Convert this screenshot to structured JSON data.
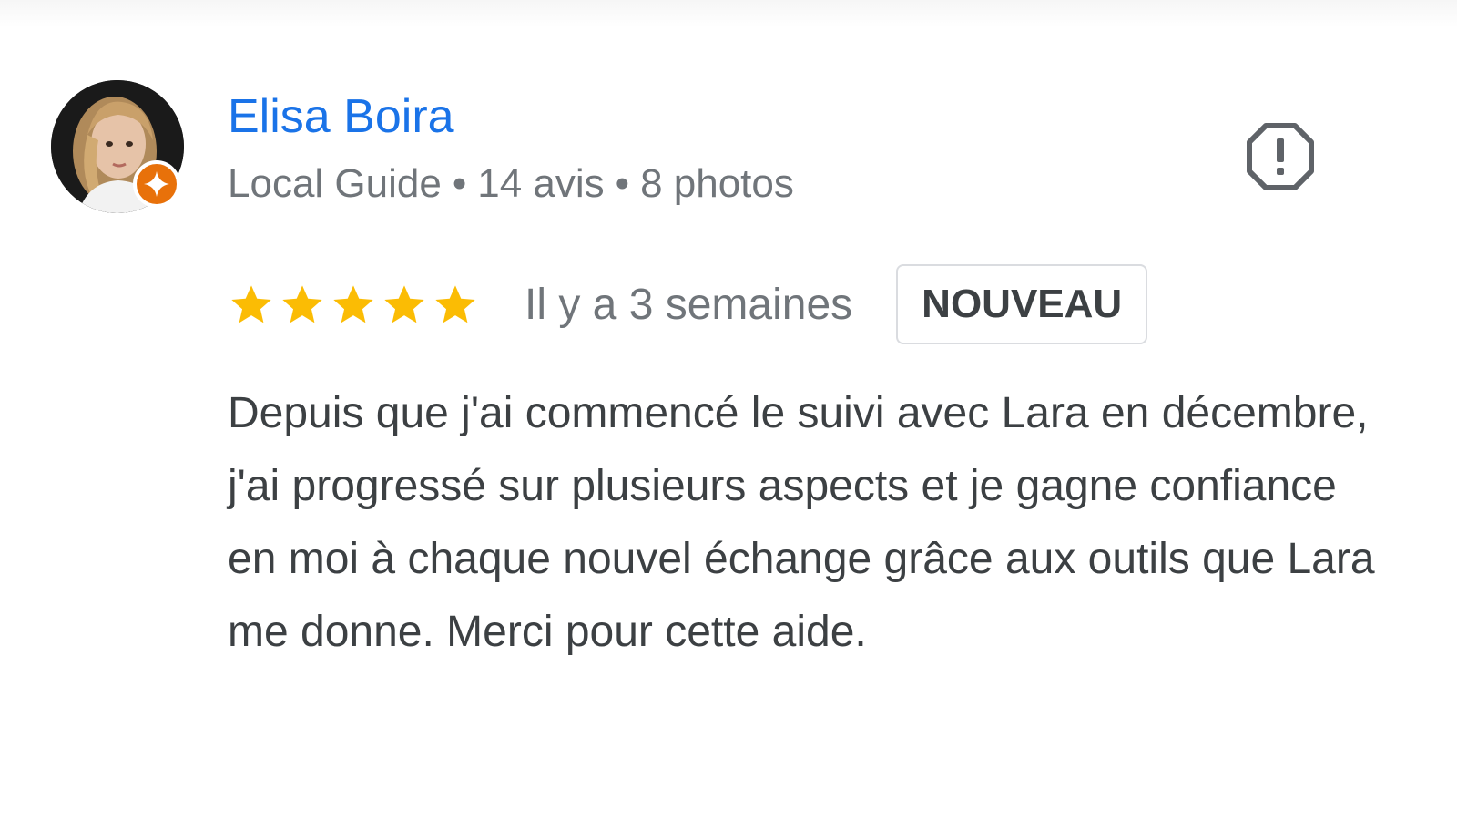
{
  "review": {
    "reviewer": {
      "name": "Elisa Boira",
      "badge": "Local Guide",
      "reviews": "14 avis",
      "photos": "8 photos",
      "separator": "•",
      "badge_color": "#e8710a",
      "name_color": "#1a73e8"
    },
    "rating": {
      "stars": 5,
      "max": 5,
      "star_color": "#fbbc04",
      "date": "Il y a 3 semaines"
    },
    "new_label": "NOUVEAU",
    "text": "Depuis que j'ai commencé le suivi avec Lara en décembre, j'ai progressé sur plusieurs aspects et je gagne confiance en moi à chaque nouvel échange grâce aux outils que Lara me donne. Merci pour cette aide.",
    "report_icon": "report-icon"
  }
}
